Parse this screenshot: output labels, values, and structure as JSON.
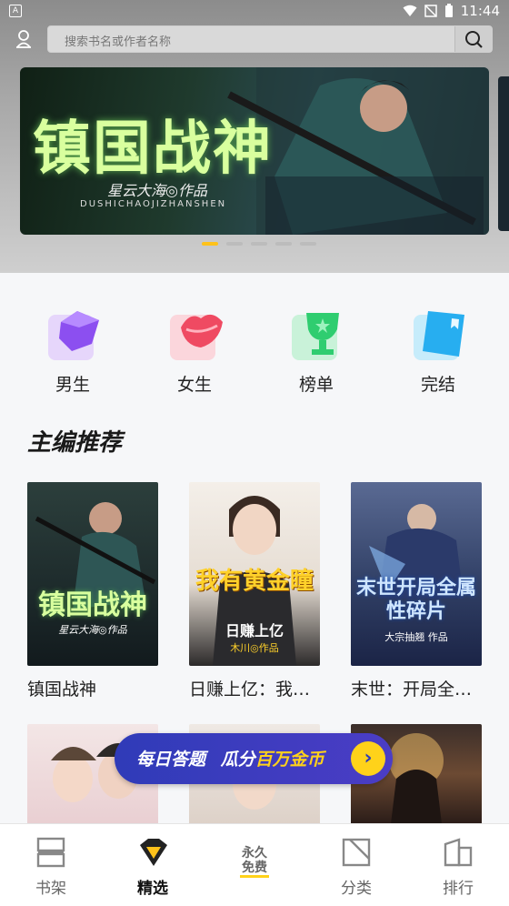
{
  "status_bar": {
    "time": "11:44",
    "left_badge": "A"
  },
  "search": {
    "placeholder": "搜索书名或作者名称"
  },
  "banner": {
    "title": "镇国战神",
    "author": "星云大海◎作品",
    "pinyin": "DUSHICHAOJIZHANSHEN",
    "active_dot": 1,
    "dot_count": 5
  },
  "categories": [
    {
      "label": "男生",
      "icon": "boy-gem-icon",
      "color": "#9b5cf0"
    },
    {
      "label": "女生",
      "icon": "lips-icon",
      "color": "#ef5a6f"
    },
    {
      "label": "榜单",
      "icon": "trophy-icon",
      "color": "#35d07a"
    },
    {
      "label": "完结",
      "icon": "book-complete-icon",
      "color": "#2fb3f0"
    }
  ],
  "section": {
    "title": "主编推荐"
  },
  "books": [
    {
      "name": "镇国战神",
      "cover_title": "镇国战神",
      "cover_author": "星云大海◎作品"
    },
    {
      "name": "日赚上亿：我…",
      "cover_title": "我有黄金瞳",
      "cover_sub": "日赚上亿",
      "cover_author": "木川◎作品"
    },
    {
      "name": "末世：开局全…",
      "cover_title": "末世开局全属性碎片",
      "cover_author": "大宗抽翘 作品"
    }
  ],
  "promo": {
    "text_a": "每日答题",
    "text_b": "瓜分",
    "text_hl": "百万金币",
    "arrow": "›"
  },
  "tabs": [
    {
      "label": "书架",
      "icon": "bookshelf-icon"
    },
    {
      "label": "精选",
      "icon": "featured-icon",
      "active": true
    },
    {
      "label": "永久免费",
      "icon": "free-forever-icon"
    },
    {
      "label": "分类",
      "icon": "category-icon"
    },
    {
      "label": "排行",
      "icon": "ranking-icon"
    }
  ],
  "colors": {
    "accent": "#ffc21a",
    "promo": "#3a3cc0"
  }
}
